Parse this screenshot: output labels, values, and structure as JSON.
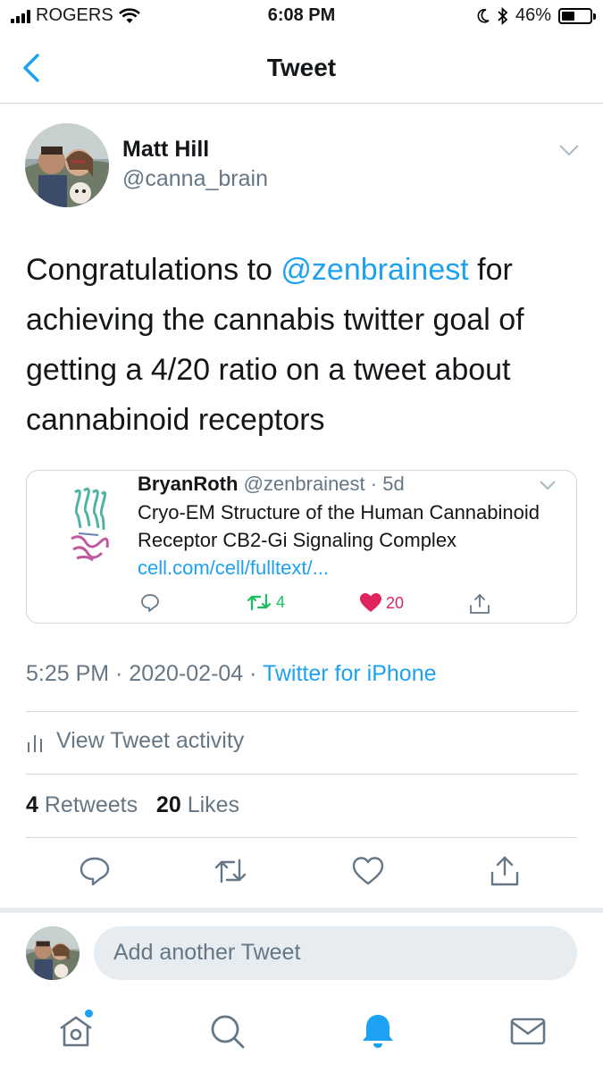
{
  "status_bar": {
    "carrier": "ROGERS",
    "time": "6:08 PM",
    "battery": "46%",
    "battery_level": 0.46
  },
  "nav": {
    "title": "Tweet",
    "back_icon": "chevron-left-icon"
  },
  "tweet": {
    "author_name": "Matt Hill",
    "author_handle": "@canna_brain",
    "text_before": "Congratulations to ",
    "mention": "@zenbrainest",
    "text_after": " for achieving the cannabis twitter goal of getting a 4/20 ratio on a tweet about cannabinoid receptors",
    "time": "5:25 PM",
    "date": "2020-02-04",
    "source": "Twitter for iPhone",
    "retweets_count": "4",
    "retweets_label": "Retweets",
    "likes_count": "20",
    "likes_label": "Likes",
    "activity_label": "View Tweet activity"
  },
  "quoted_tweet": {
    "name": "BryanRoth",
    "handle": "@zenbrainest",
    "age": "5d",
    "text": "Cryo-EM Structure of the Human Cannabinoid Receptor CB2-Gi Signaling Complex ",
    "link": "cell.com/cell/fulltext/...",
    "retweets": "4",
    "likes": "20"
  },
  "compose": {
    "placeholder": "Add another Tweet"
  },
  "colors": {
    "accent": "#1da1f2",
    "retweet_green": "#17bf63",
    "like_red": "#e0245e",
    "muted": "#657786"
  },
  "tab_bar": {
    "items": [
      "home-icon",
      "search-icon",
      "notifications-icon",
      "messages-icon"
    ],
    "active": "notifications-icon"
  }
}
